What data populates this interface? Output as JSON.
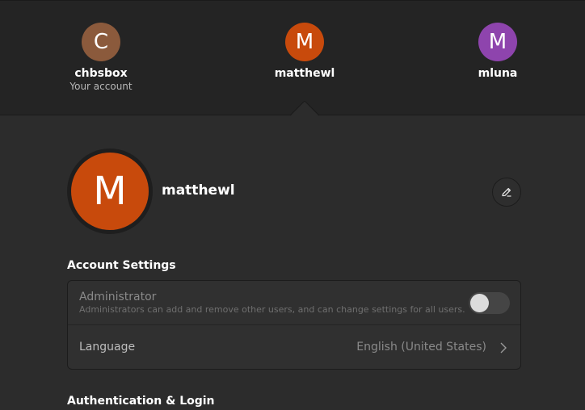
{
  "users": [
    {
      "initial": "C",
      "name": "chbsbox",
      "subtitle": "Your account",
      "color": "#8b5a3c"
    },
    {
      "initial": "M",
      "name": "matthewl",
      "subtitle": "",
      "color": "#c84a0c"
    },
    {
      "initial": "M",
      "name": "mluna",
      "subtitle": "",
      "color": "#8e44ad"
    }
  ],
  "profile": {
    "initial": "M",
    "name": "matthewl",
    "avatar_color": "#c84a0c",
    "edit_icon": "pencil-icon"
  },
  "account_settings": {
    "title": "Account Settings",
    "administrator": {
      "label": "Administrator",
      "description": "Administrators can add and remove other users, and can change settings for all users.",
      "enabled": false
    },
    "language": {
      "label": "Language",
      "value": "English (United States)",
      "icon": "chevron-right-icon"
    }
  },
  "authentication": {
    "title": "Authentication & Login"
  }
}
